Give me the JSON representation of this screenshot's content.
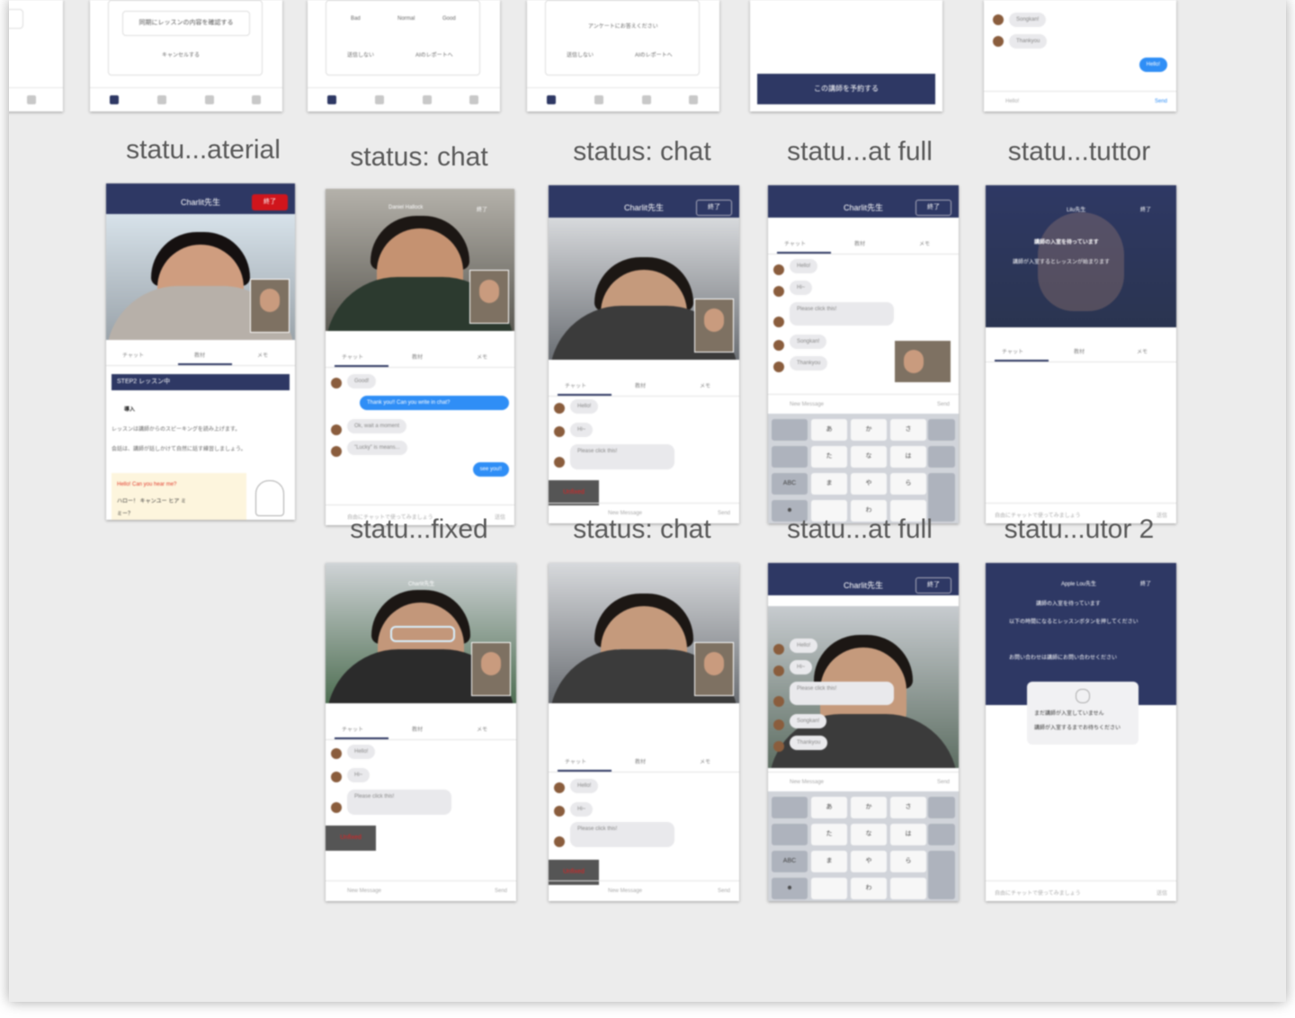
{
  "labels": [
    "statu...aterial",
    "status: chat",
    "status: chat",
    "statu...at full",
    "statu...tuttor",
    "statu...fixed",
    "status: chat",
    "statu...at full",
    "statu...utor 2"
  ],
  "top_row": {
    "card1_button": "同期にレッスンの内容を確認する",
    "card1_cancel": "キャンセルする",
    "card2_opts": [
      "Bad",
      "Normal",
      "Good"
    ],
    "card2_left": "送信しない",
    "card2_right": "AIのレポートへ",
    "card3_survey": "アンケートにお答えください",
    "card3_left": "送信しない",
    "card3_right": "AIのレポートへ",
    "card4_button": "この講師を予約する",
    "card5_msgs": [
      "Songkan!",
      "Thankyou"
    ],
    "card5_me": "Hello!",
    "card5_input": "Hello!",
    "card5_send": "Send"
  },
  "material": {
    "nav_title": "Charlit先生",
    "end_btn": "終了",
    "tab_chat": "チャット",
    "tab_material": "教材",
    "tab_note": "メモ",
    "step_title": "STEP2 レッスン中",
    "intro": "導入",
    "body_text": "レッスンは講師からのスピーキングを読み上げます。",
    "body_text2": "会話は、講師が話しかけて自然に話す練習しましょう。",
    "teacher_line": "Hello! Can you hear me?",
    "jp_line": "ハロー！ キャンユー ヒア ミ",
    "jp_note": "ミー？"
  },
  "chat_b": {
    "nav_title": "Daniel Hallock",
    "end_btn": "終了",
    "tab_chat": "チャット",
    "tab_material": "教材",
    "tab_note": "メモ",
    "msgs": [
      "Good!",
      "Ok, wait a moment",
      "\"Lucky\" is means..."
    ],
    "me_msgs": [
      "Thank you!! Can you write in chat?",
      "see you!!"
    ],
    "input": "自由にチャットで使ってみましょう",
    "send": "送信"
  },
  "chat_c": {
    "nav_title": "Charlit先生",
    "end_btn": "終了",
    "tab_chat": "チャット",
    "tab_material": "教材",
    "tab_note": "メモ",
    "msgs": [
      "Hello!",
      "Hi~",
      "Please click this!"
    ],
    "end_label": "Unfixed",
    "input": "New Message",
    "send": "Send"
  },
  "chat_full_d": {
    "nav_title": "Charlit先生",
    "end_btn": "終了",
    "tab_chat": "チャット",
    "tab_material": "教材",
    "tab_note": "メモ",
    "msgs": [
      "Hello!",
      "Hi~",
      "Please click this!",
      "Songkan!",
      "Thankyou"
    ],
    "input": "New Message",
    "send": "Send",
    "keys": [
      "あ",
      "か",
      "さ",
      "た",
      "な",
      "は",
      "ま",
      "や",
      "ら",
      "ABC",
      "☻",
      "わ"
    ]
  },
  "tutor_e": {
    "nav_title": "Lilu先生",
    "end_btn": "終了",
    "line1": "講師の入室を待っています",
    "line2": "講師が入室するとレッスンが始まります",
    "tab_chat": "チャット",
    "tab_material": "教材",
    "tab_note": "メモ",
    "input": "自由にチャットで使ってみましょう",
    "send": "送信"
  },
  "fixed_f": {
    "nav_title": "Charlit先生",
    "tab_chat": "チャット",
    "tab_material": "教材",
    "tab_note": "メモ",
    "msgs": [
      "Hello!",
      "Hi~",
      "Please click this!"
    ],
    "end_label": "Unfixed",
    "input": "New Message",
    "send": "Send"
  },
  "chat_g": {
    "tab_chat": "チャット",
    "tab_material": "教材",
    "tab_note": "メモ",
    "msgs": [
      "Hello!",
      "Hi~",
      "Please click this!"
    ],
    "end_label": "Unfixed",
    "input": "New Message",
    "send": "Send"
  },
  "chat_full_h": {
    "nav_title": "Charlit先生",
    "end_btn": "終了",
    "msgs": [
      "Hello!",
      "Hi~",
      "Please click this!",
      "Songkan!",
      "Thankyou"
    ],
    "input": "New Message",
    "send": "Send",
    "keys": [
      "あ",
      "か",
      "さ",
      "た",
      "な",
      "は",
      "ま",
      "や",
      "ら",
      "ABC",
      "☻",
      "わ"
    ]
  },
  "tutor2_i": {
    "nav_title": "Apple Lou先生",
    "end_btn": "終了",
    "line1": "講師の入室を待っています",
    "line2": "以下の時間になるとレッスンボタンを押してください",
    "line3": "お問い合わせは講師にお問い合わせください",
    "popup": "まだ講師が入室していません",
    "popup2": "講師が入室するまでお待ちください",
    "input": "自由にチャットで使ってみましょう",
    "send": "送信"
  }
}
